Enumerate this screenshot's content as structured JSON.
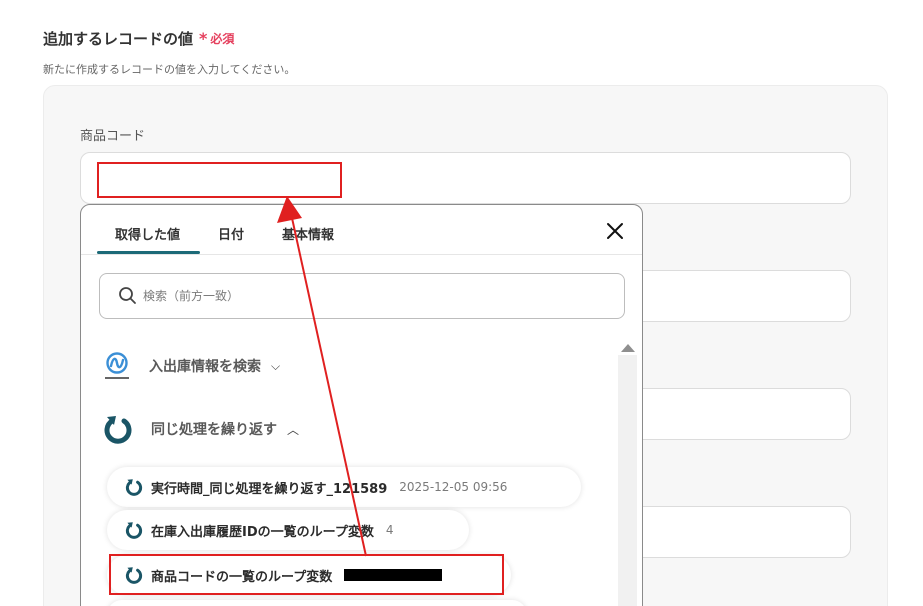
{
  "section": {
    "title": "追加するレコードの値",
    "required_label": "必須",
    "description": "新たに作成するレコードの値を入力してください。"
  },
  "field": {
    "label": "商品コード"
  },
  "popup": {
    "tabs": [
      "取得した値",
      "日付",
      "基本情報"
    ],
    "search_placeholder": "検索（前方一致）",
    "groups": [
      {
        "label": "入出庫情報を検索",
        "icon": "next-engine-logo-icon",
        "expanded": false
      },
      {
        "label": "同じ処理を繰り返す",
        "icon": "loop-icon",
        "expanded": true
      }
    ],
    "items": [
      {
        "label": "実行時間_同じ処理を繰り返す_121589",
        "value": "2025-12-05 09:56"
      },
      {
        "label": "在庫入出庫履歴IDの一覧のループ変数",
        "value": "4"
      },
      {
        "label": "商品コードの一覧のループ変数",
        "value": ""
      }
    ]
  },
  "colors": {
    "accent": "#1c6a78",
    "required": "#e5405e",
    "annotation": "#e02020"
  }
}
